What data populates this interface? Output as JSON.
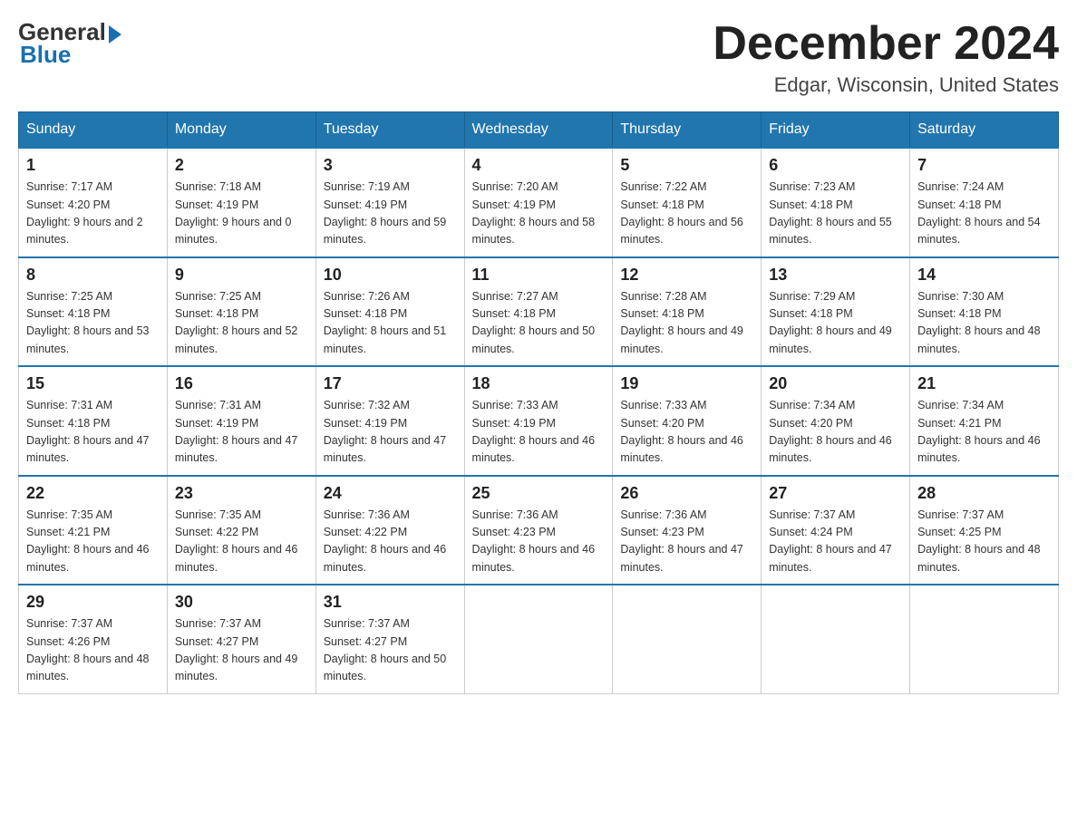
{
  "logo": {
    "general": "General",
    "blue": "Blue"
  },
  "title": "December 2024",
  "subtitle": "Edgar, Wisconsin, United States",
  "days_of_week": [
    "Sunday",
    "Monday",
    "Tuesday",
    "Wednesday",
    "Thursday",
    "Friday",
    "Saturday"
  ],
  "weeks": [
    [
      {
        "day": "1",
        "sunrise": "7:17 AM",
        "sunset": "4:20 PM",
        "daylight": "9 hours and 2 minutes."
      },
      {
        "day": "2",
        "sunrise": "7:18 AM",
        "sunset": "4:19 PM",
        "daylight": "9 hours and 0 minutes."
      },
      {
        "day": "3",
        "sunrise": "7:19 AM",
        "sunset": "4:19 PM",
        "daylight": "8 hours and 59 minutes."
      },
      {
        "day": "4",
        "sunrise": "7:20 AM",
        "sunset": "4:19 PM",
        "daylight": "8 hours and 58 minutes."
      },
      {
        "day": "5",
        "sunrise": "7:22 AM",
        "sunset": "4:18 PM",
        "daylight": "8 hours and 56 minutes."
      },
      {
        "day": "6",
        "sunrise": "7:23 AM",
        "sunset": "4:18 PM",
        "daylight": "8 hours and 55 minutes."
      },
      {
        "day": "7",
        "sunrise": "7:24 AM",
        "sunset": "4:18 PM",
        "daylight": "8 hours and 54 minutes."
      }
    ],
    [
      {
        "day": "8",
        "sunrise": "7:25 AM",
        "sunset": "4:18 PM",
        "daylight": "8 hours and 53 minutes."
      },
      {
        "day": "9",
        "sunrise": "7:25 AM",
        "sunset": "4:18 PM",
        "daylight": "8 hours and 52 minutes."
      },
      {
        "day": "10",
        "sunrise": "7:26 AM",
        "sunset": "4:18 PM",
        "daylight": "8 hours and 51 minutes."
      },
      {
        "day": "11",
        "sunrise": "7:27 AM",
        "sunset": "4:18 PM",
        "daylight": "8 hours and 50 minutes."
      },
      {
        "day": "12",
        "sunrise": "7:28 AM",
        "sunset": "4:18 PM",
        "daylight": "8 hours and 49 minutes."
      },
      {
        "day": "13",
        "sunrise": "7:29 AM",
        "sunset": "4:18 PM",
        "daylight": "8 hours and 49 minutes."
      },
      {
        "day": "14",
        "sunrise": "7:30 AM",
        "sunset": "4:18 PM",
        "daylight": "8 hours and 48 minutes."
      }
    ],
    [
      {
        "day": "15",
        "sunrise": "7:31 AM",
        "sunset": "4:18 PM",
        "daylight": "8 hours and 47 minutes."
      },
      {
        "day": "16",
        "sunrise": "7:31 AM",
        "sunset": "4:19 PM",
        "daylight": "8 hours and 47 minutes."
      },
      {
        "day": "17",
        "sunrise": "7:32 AM",
        "sunset": "4:19 PM",
        "daylight": "8 hours and 47 minutes."
      },
      {
        "day": "18",
        "sunrise": "7:33 AM",
        "sunset": "4:19 PM",
        "daylight": "8 hours and 46 minutes."
      },
      {
        "day": "19",
        "sunrise": "7:33 AM",
        "sunset": "4:20 PM",
        "daylight": "8 hours and 46 minutes."
      },
      {
        "day": "20",
        "sunrise": "7:34 AM",
        "sunset": "4:20 PM",
        "daylight": "8 hours and 46 minutes."
      },
      {
        "day": "21",
        "sunrise": "7:34 AM",
        "sunset": "4:21 PM",
        "daylight": "8 hours and 46 minutes."
      }
    ],
    [
      {
        "day": "22",
        "sunrise": "7:35 AM",
        "sunset": "4:21 PM",
        "daylight": "8 hours and 46 minutes."
      },
      {
        "day": "23",
        "sunrise": "7:35 AM",
        "sunset": "4:22 PM",
        "daylight": "8 hours and 46 minutes."
      },
      {
        "day": "24",
        "sunrise": "7:36 AM",
        "sunset": "4:22 PM",
        "daylight": "8 hours and 46 minutes."
      },
      {
        "day": "25",
        "sunrise": "7:36 AM",
        "sunset": "4:23 PM",
        "daylight": "8 hours and 46 minutes."
      },
      {
        "day": "26",
        "sunrise": "7:36 AM",
        "sunset": "4:23 PM",
        "daylight": "8 hours and 47 minutes."
      },
      {
        "day": "27",
        "sunrise": "7:37 AM",
        "sunset": "4:24 PM",
        "daylight": "8 hours and 47 minutes."
      },
      {
        "day": "28",
        "sunrise": "7:37 AM",
        "sunset": "4:25 PM",
        "daylight": "8 hours and 48 minutes."
      }
    ],
    [
      {
        "day": "29",
        "sunrise": "7:37 AM",
        "sunset": "4:26 PM",
        "daylight": "8 hours and 48 minutes."
      },
      {
        "day": "30",
        "sunrise": "7:37 AM",
        "sunset": "4:27 PM",
        "daylight": "8 hours and 49 minutes."
      },
      {
        "day": "31",
        "sunrise": "7:37 AM",
        "sunset": "4:27 PM",
        "daylight": "8 hours and 50 minutes."
      },
      null,
      null,
      null,
      null
    ]
  ],
  "labels": {
    "sunrise": "Sunrise:",
    "sunset": "Sunset:",
    "daylight": "Daylight:"
  },
  "colors": {
    "header_bg": "#2176ae",
    "header_text": "#ffffff",
    "accent": "#1a6faf"
  }
}
